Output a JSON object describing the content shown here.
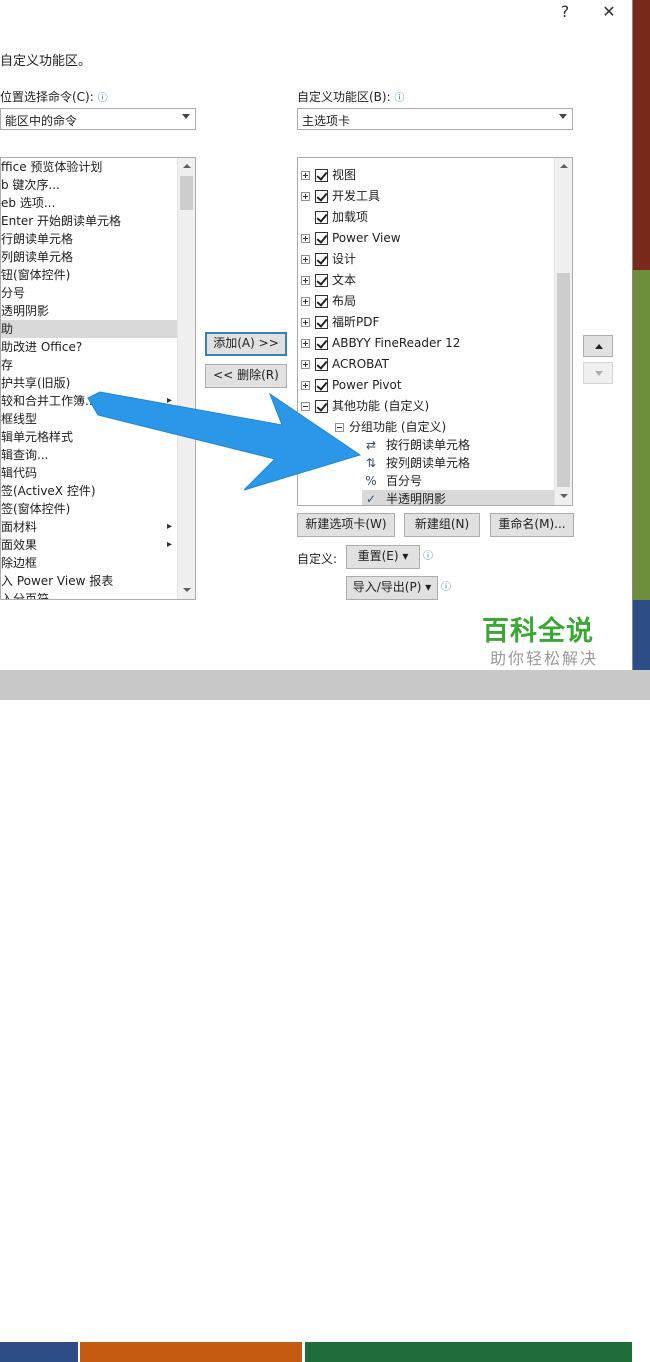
{
  "window": {
    "help_glyph": "?",
    "close_glyph": "✕"
  },
  "section_title": "自定义功能区。",
  "left": {
    "label": "位置选择命令(C):",
    "combo_value": "能区中的命令",
    "items": [
      "ffice 预览体验计划",
      "b 键次序...",
      "eb 选项...",
      " Enter 开始朗读单元格",
      "行朗读单元格",
      "列朗读单元格",
      "钮(窗体控件)",
      "分号",
      "透明阴影",
      "助",
      "助改进 Office?",
      "存",
      "护共享(旧版)",
      "较和合并工作簿...",
      "框线型",
      "辑单元格样式",
      "辑查询...",
      "辑代码",
      "签(ActiveX 控件)",
      "签(窗体控件)",
      "面材料",
      "面效果",
      "除边框",
      "入 Power View 报表",
      "入分页符"
    ],
    "selected_index": 9
  },
  "middle": {
    "add_label": "添加(A) >>",
    "remove_label": "<< 删除(R)"
  },
  "right": {
    "label": "自定义功能区(B):",
    "combo_value": "主选项卡",
    "tree": [
      {
        "label": "视图",
        "checked": true,
        "expander": "plus"
      },
      {
        "label": "开发工具",
        "checked": true,
        "expander": "plus"
      },
      {
        "label": "加载项",
        "checked": true,
        "expander": "none"
      },
      {
        "label": "Power View",
        "checked": true,
        "expander": "plus"
      },
      {
        "label": "设计",
        "checked": true,
        "expander": "plus"
      },
      {
        "label": "文本",
        "checked": true,
        "expander": "plus"
      },
      {
        "label": "布局",
        "checked": true,
        "expander": "plus"
      },
      {
        "label": "福昕PDF",
        "checked": true,
        "expander": "plus"
      },
      {
        "label": "ABBYY FineReader 12",
        "checked": true,
        "expander": "plus"
      },
      {
        "label": "ACROBAT",
        "checked": true,
        "expander": "plus"
      },
      {
        "label": "Power Pivot",
        "checked": true,
        "expander": "plus"
      },
      {
        "label": "其他功能 (自定义)",
        "checked": true,
        "expander": "minus"
      }
    ],
    "group_label": "分组功能 (自定义)",
    "group_items": [
      {
        "label": "按行朗读单元格",
        "icon": "read-rows-icon"
      },
      {
        "label": "按列朗读单元格",
        "icon": "read-columns-icon"
      },
      {
        "label": "百分号",
        "icon": "percent-icon"
      },
      {
        "label": "半透明阴影",
        "icon": "checkmark-icon"
      }
    ],
    "selected_group_item": 3,
    "new_tab_label": "新建选项卡(W)",
    "new_group_label": "新建组(N)",
    "rename_label": "重命名(M)...",
    "customize_label": "自定义:",
    "reset_label": "重置(E) ▾",
    "import_export_label": "导入/导出(P) ▾"
  },
  "watermark": {
    "title": "百科全说",
    "subtitle": "助你轻松解决"
  },
  "colors": {
    "arrow": "#2b97e8",
    "accent": "#3c7fb1",
    "watermark_green": "#3aa835"
  }
}
